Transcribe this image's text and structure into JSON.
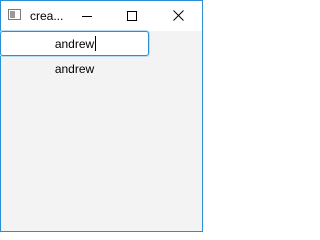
{
  "window": {
    "title": "crea...",
    "accent_color": "#2b8fd6",
    "background_color": "#f3f3f3"
  },
  "icons": {
    "app": "app-window-icon",
    "minimize": "minimize-icon",
    "maximize": "maximize-icon",
    "close": "close-icon"
  },
  "form": {
    "input_value": "andrew",
    "output_label": "andrew"
  }
}
